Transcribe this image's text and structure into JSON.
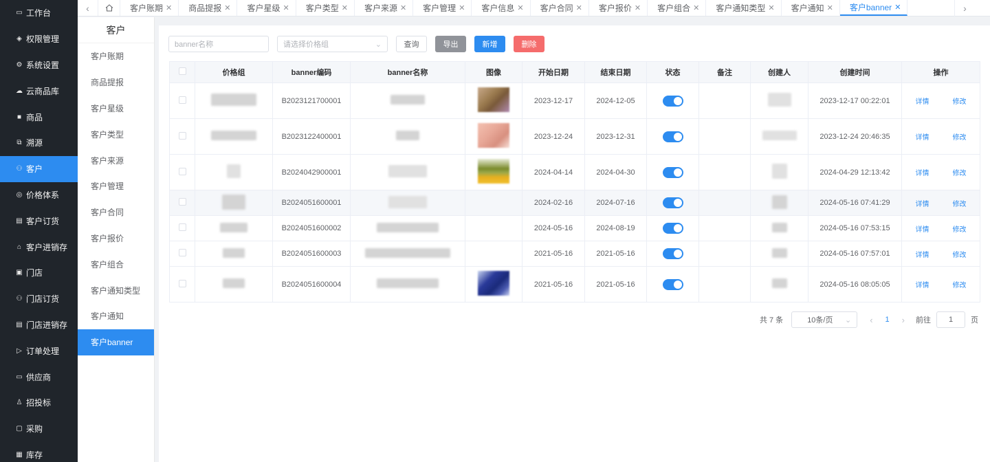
{
  "sidebar": {
    "items": [
      {
        "label": "工作台",
        "icon": "monitor-icon"
      },
      {
        "label": "权限管理",
        "icon": "shield-icon"
      },
      {
        "label": "系统设置",
        "icon": "gear-icon"
      },
      {
        "label": "云商品库",
        "icon": "cloud-icon"
      },
      {
        "label": "商品",
        "icon": "box-icon"
      },
      {
        "label": "溯源",
        "icon": "trace-icon"
      },
      {
        "label": "客户",
        "icon": "user-icon",
        "active": true
      },
      {
        "label": "价格体系",
        "icon": "price-icon"
      },
      {
        "label": "客户订货",
        "icon": "order-icon"
      },
      {
        "label": "客户进销存",
        "icon": "warehouse-icon"
      },
      {
        "label": "门店",
        "icon": "store-icon"
      },
      {
        "label": "门店订货",
        "icon": "store-order-icon"
      },
      {
        "label": "门店进销存",
        "icon": "store-stock-icon"
      },
      {
        "label": "订单处理",
        "icon": "send-icon"
      },
      {
        "label": "供应商",
        "icon": "supplier-icon"
      },
      {
        "label": "招投标",
        "icon": "bid-icon"
      },
      {
        "label": "采购",
        "icon": "purchase-icon"
      },
      {
        "label": "库存",
        "icon": "inventory-icon"
      }
    ]
  },
  "tabs": [
    {
      "label": "客户账期"
    },
    {
      "label": "商品提报"
    },
    {
      "label": "客户星级"
    },
    {
      "label": "客户类型"
    },
    {
      "label": "客户来源"
    },
    {
      "label": "客户管理"
    },
    {
      "label": "客户信息"
    },
    {
      "label": "客户合同"
    },
    {
      "label": "客户报价"
    },
    {
      "label": "客户组合"
    },
    {
      "label": "客户通知类型"
    },
    {
      "label": "客户通知"
    },
    {
      "label": "客户banner",
      "active": true
    }
  ],
  "submenu": {
    "title": "客户",
    "items": [
      {
        "label": "客户账期"
      },
      {
        "label": "商品提报"
      },
      {
        "label": "客户星级"
      },
      {
        "label": "客户类型"
      },
      {
        "label": "客户来源"
      },
      {
        "label": "客户管理"
      },
      {
        "label": "客户合同"
      },
      {
        "label": "客户报价"
      },
      {
        "label": "客户组合"
      },
      {
        "label": "客户通知类型"
      },
      {
        "label": "客户通知"
      },
      {
        "label": "客户banner",
        "active": true
      }
    ]
  },
  "toolbar": {
    "name_placeholder": "banner名称",
    "price_group_placeholder": "请选择价格组",
    "query": "查询",
    "export": "导出",
    "add": "新增",
    "delete": "删除"
  },
  "table": {
    "headers": [
      "价格组",
      "banner编码",
      "banner名称",
      "图像",
      "开始日期",
      "结束日期",
      "状态",
      "备注",
      "创建人",
      "创建时间",
      "操作"
    ],
    "rows": [
      {
        "code": "B2023121700001",
        "start": "2023-12-17",
        "end": "2024-12-05",
        "created": "2023-12-17 00:22:01",
        "enabled": true
      },
      {
        "code": "B2023122400001",
        "start": "2023-12-24",
        "end": "2023-12-31",
        "created": "2023-12-24 20:46:35",
        "enabled": true
      },
      {
        "code": "B2024042900001",
        "start": "2024-04-14",
        "end": "2024-04-30",
        "created": "2024-04-29 12:13:42",
        "enabled": true
      },
      {
        "code": "B2024051600001",
        "start": "2024-02-16",
        "end": "2024-07-16",
        "created": "2024-05-16 07:41:29",
        "enabled": true
      },
      {
        "code": "B2024051600002",
        "start": "2024-05-16",
        "end": "2024-08-19",
        "created": "2024-05-16 07:53:15",
        "enabled": true
      },
      {
        "code": "B2024051600003",
        "start": "2021-05-16",
        "end": "2021-05-16",
        "created": "2024-05-16 07:57:01",
        "enabled": true
      },
      {
        "code": "B2024051600004",
        "start": "2021-05-16",
        "end": "2021-05-16",
        "created": "2024-05-16 08:05:05",
        "enabled": true
      }
    ],
    "action_detail": "详情",
    "action_edit": "修改"
  },
  "pagination": {
    "total": "共 7 条",
    "page_size": "10条/页",
    "current_page": "1",
    "goto_label": "前往",
    "goto_value": "1",
    "page_suffix": "页"
  },
  "colors": {
    "primary": "#2d8cf0",
    "sidebar_bg": "#20252b",
    "danger": "#f56c6c",
    "neutral_button": "#909399"
  }
}
